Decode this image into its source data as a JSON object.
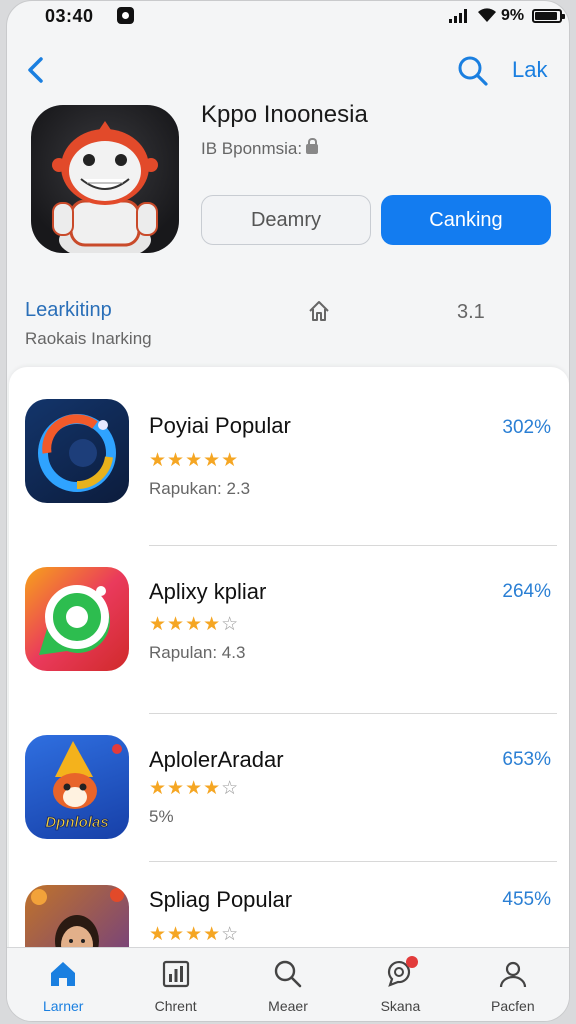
{
  "status_bar": {
    "time": "03:40",
    "battery": "9%"
  },
  "nav": {
    "link_label": "Lak"
  },
  "header": {
    "title": "Kppo Inoonesia",
    "subtitle": "IB Bponmsia:",
    "secondary_button": "Deamry",
    "primary_button": "Canking",
    "accent_color": "#137cf0"
  },
  "ranking": {
    "title": "Learkitinp",
    "subtitle": "Raokais Inarking",
    "value": "3.1"
  },
  "list": [
    {
      "name": "Poyiai Popular",
      "rating_stars": 5,
      "meta": "Rapukan: 2.3",
      "percent": "302%"
    },
    {
      "name": "Aplixy kpliar",
      "rating_stars": 4,
      "meta": "Rapulan: 4.3",
      "percent": "264%"
    },
    {
      "name": "AplolerAradar",
      "rating_stars": 4,
      "meta": "5%",
      "percent": "653%"
    },
    {
      "name": "Spliag Popular",
      "rating_stars": 4,
      "meta": "",
      "percent": "455%"
    }
  ],
  "list_icon_text": {
    "third": "Dpnlolas"
  },
  "tabs": [
    {
      "label": "Larner",
      "icon": "home-icon",
      "active": true
    },
    {
      "label": "Chrent",
      "icon": "chart-icon",
      "active": false
    },
    {
      "label": "Meaer",
      "icon": "search-icon",
      "active": false
    },
    {
      "label": "Skana",
      "icon": "chat-search-icon",
      "active": false,
      "badge": "1"
    },
    {
      "label": "Pacfen",
      "icon": "profile-icon",
      "active": false
    }
  ]
}
